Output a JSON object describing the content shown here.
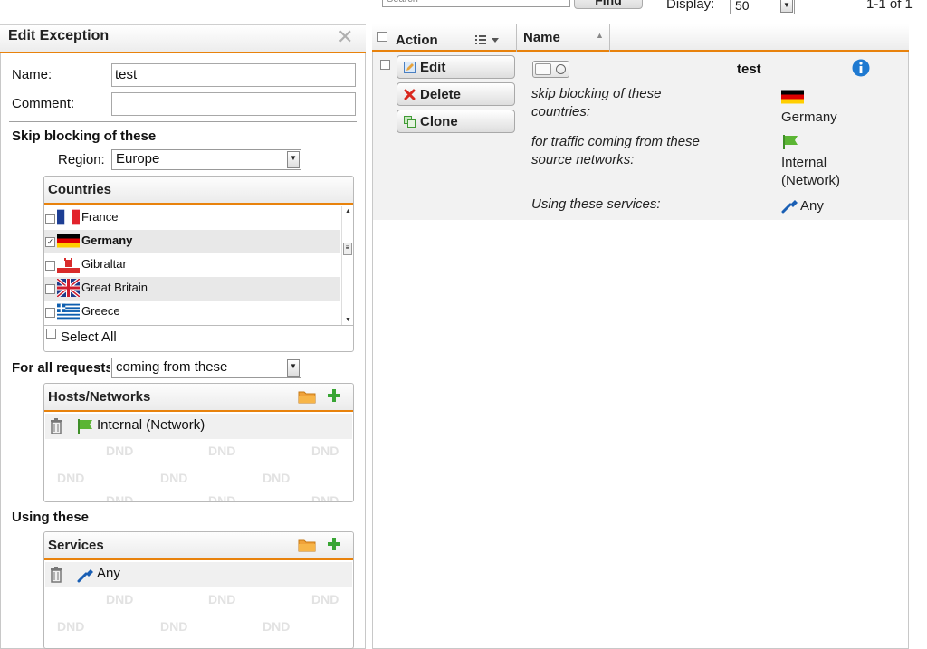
{
  "toolbar": {
    "search_placeholder": "Search",
    "find_label": "Find",
    "display_label": "Display:",
    "display_value": "50",
    "pager_text": "1-1 of 1"
  },
  "panel": {
    "title": "Edit Exception",
    "name_label": "Name:",
    "name_value": "test",
    "comment_label": "Comment:",
    "comment_value": "",
    "skip_title": "Skip blocking of these",
    "region_label": "Region:",
    "region_value": "Europe",
    "countries": {
      "title": "Countries",
      "items": [
        {
          "name": "France",
          "checked": false,
          "selected": false
        },
        {
          "name": "Germany",
          "checked": true,
          "selected": true
        },
        {
          "name": "Gibraltar",
          "checked": false,
          "selected": false
        },
        {
          "name": "Great Britain",
          "checked": false,
          "selected": false
        },
        {
          "name": "Greece",
          "checked": false,
          "selected": false
        }
      ],
      "select_all_label": "Select All"
    },
    "requests_label": "For all requests",
    "requests_value": "coming from these",
    "hosts": {
      "title": "Hosts/Networks",
      "items": [
        {
          "label": "Internal (Network)"
        }
      ],
      "dnd": "DND"
    },
    "using_title": "Using these",
    "services": {
      "title": "Services",
      "items": [
        {
          "label": "Any"
        }
      ],
      "dnd": "DND"
    }
  },
  "grid": {
    "columns": {
      "action": "Action",
      "name": "Name"
    },
    "row": {
      "buttons": {
        "edit": "Edit",
        "delete": "Delete",
        "clone": "Clone"
      },
      "name": "test",
      "skip_text_1": "skip blocking of these",
      "skip_text_2": "countries:",
      "skip_value": "Germany",
      "traffic_text_1": "for traffic coming from these",
      "traffic_text_2": "source networks:",
      "traffic_value_1": "Internal",
      "traffic_value_2": "(Network)",
      "services_text": "Using these services:",
      "services_value": "Any"
    }
  },
  "colors": {
    "accent": "#e8820c",
    "info": "#1f7ad1",
    "network_green": "#5bb534",
    "delete_red": "#d9261c"
  }
}
